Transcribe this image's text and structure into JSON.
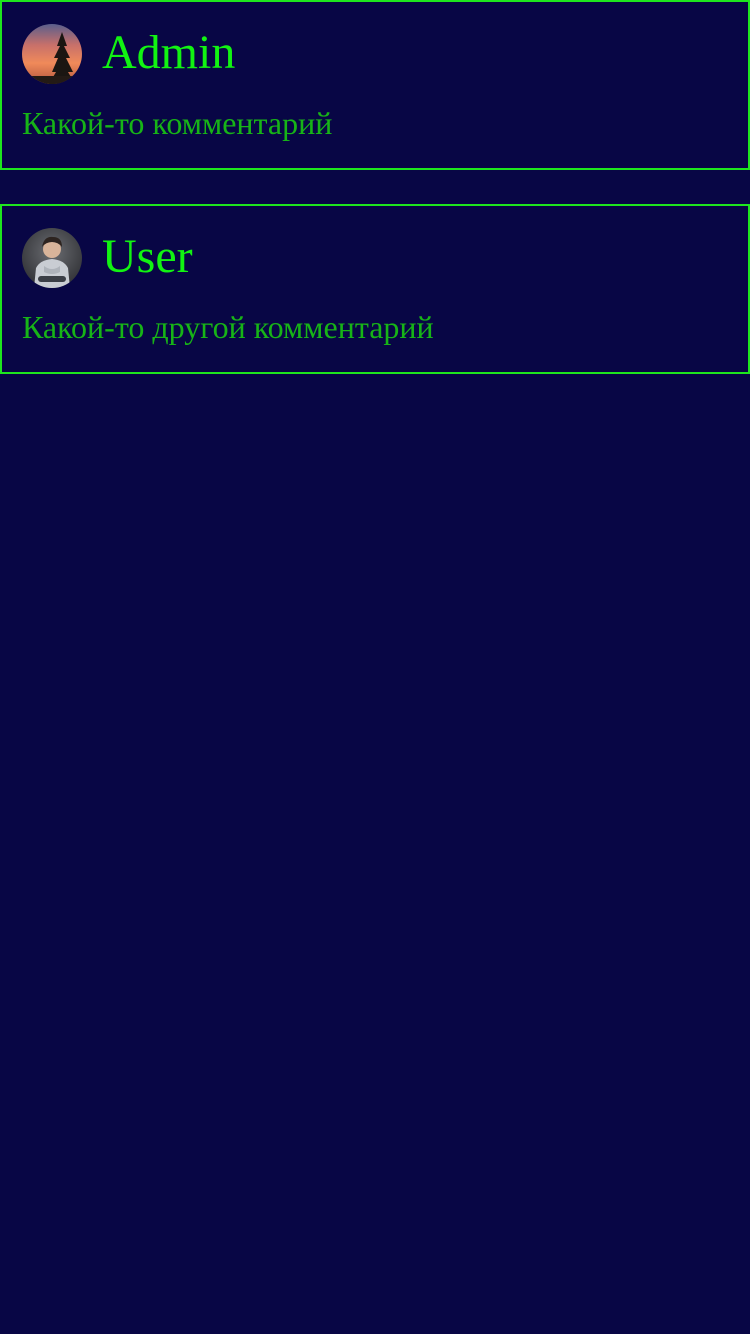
{
  "theme": {
    "background": "#080645",
    "border": "#1ee61e",
    "username_color": "#12f312",
    "comment_color": "#17b417"
  },
  "comments": [
    {
      "username": "Admin",
      "text": "Какой-то комментарий",
      "avatar": "sunset-tree-photo"
    },
    {
      "username": "User",
      "text": "Какой-то другой комментарий",
      "avatar": "person-in-hoodie-photo"
    }
  ]
}
